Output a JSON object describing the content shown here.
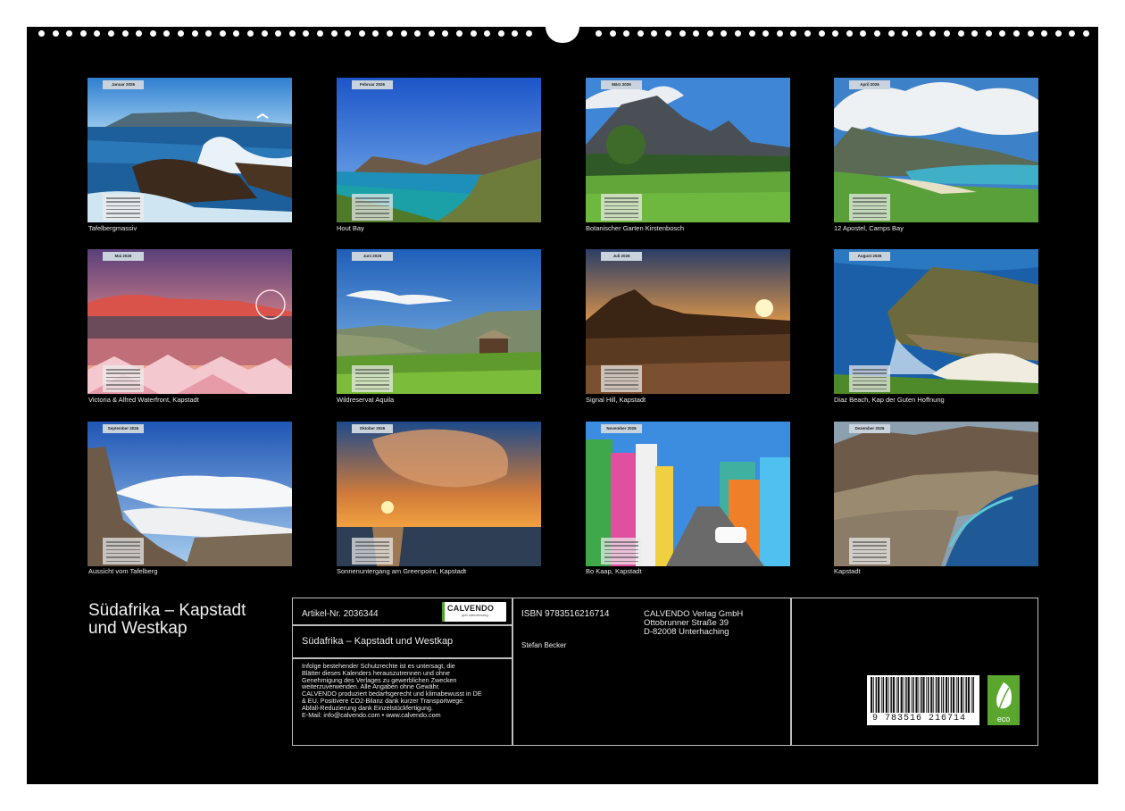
{
  "months": [
    {
      "tag": "Januar 2026",
      "caption": "Tafelbergmassiv"
    },
    {
      "tag": "Februar 2026",
      "caption": "Hout Bay"
    },
    {
      "tag": "März 2026",
      "caption": "Botanischer Garten Kirstenbosch"
    },
    {
      "tag": "April 2026",
      "caption": "12 Apostel, Camps Bay"
    },
    {
      "tag": "Mai 2026",
      "caption": "Victoria & Alfred Waterfront, Kapstadt"
    },
    {
      "tag": "Juni 2026",
      "caption": "Wildreservat Aquila"
    },
    {
      "tag": "Juli 2026",
      "caption": "Signal Hill, Kapstadt"
    },
    {
      "tag": "August 2026",
      "caption": "Diaz Beach, Kap der Guten Hoffnung"
    },
    {
      "tag": "September 2026",
      "caption": "Aussicht vom Tafelberg"
    },
    {
      "tag": "Oktober 2026",
      "caption": "Sonnenuntergang am Greenpoint, Kapstadt"
    },
    {
      "tag": "November 2026",
      "caption": "Bo Kaap, Kapstadt"
    },
    {
      "tag": "Dezember 2026",
      "caption": "Kapstadt"
    }
  ],
  "title_line1": "Südafrika – Kapstadt",
  "title_line2": "und Westkap",
  "info": {
    "article": "Artikel-Nr. 2036344",
    "logo_text": "CALVENDO",
    "logo_sub": "gern kalendersweg",
    "product_title": "Südafrika – Kapstadt und Westkap",
    "legal": [
      "Infolge bestehender Schutzrechte ist es untersagt, die",
      "Blätter dieses Kalenders herauszutrennen und ohne",
      "Genehmigung des Verlages zu gewerblichen Zwecken",
      "weiterzuverwenden. Alle Angaben ohne Gewähr.",
      "CALVENDO produziert bedarfsgerecht und klimabewusst in DE",
      "& EU. Positivere CO2-Bilanz dank kurzer Transportwege.",
      "Abfall-Reduzierung dank Einzelstückfertigung.",
      "E-Mail: info@calvendo.com • www.calvendo.com"
    ],
    "isbn": "ISBN 9783516216714",
    "author": "Stefan Becker",
    "publisher": [
      "CALVENDO Verlag GmbH",
      "Ottobrunner Straße 39",
      "D-82008 Unterhaching"
    ],
    "barcode_number": "9 783516 216714",
    "eco_label": "eco"
  }
}
